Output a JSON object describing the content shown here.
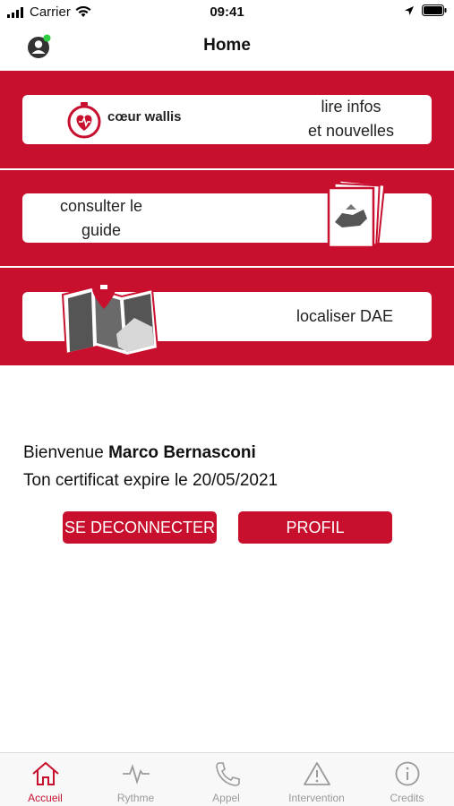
{
  "status_bar": {
    "carrier": "Carrier",
    "time": "09:41",
    "icons": [
      "signal-icon",
      "wifi-icon",
      "location-arrow-icon",
      "battery-icon"
    ]
  },
  "nav": {
    "title": "Home",
    "avatar_icon": "user-avatar-icon",
    "online_dot_color": "#2ecc40"
  },
  "cards": {
    "news": {
      "brand": "cœur wallis",
      "label_line1": "lire infos",
      "label_line2": "et nouvelles"
    },
    "guide": {
      "label_line1": "consulter le",
      "label_line2": "guide"
    },
    "map": {
      "label": "localiser DAE"
    }
  },
  "welcome": {
    "greeting_prefix": "Bienvenue ",
    "user_name": "Marco Bernasconi",
    "certificate_text": "Ton certificat expire le 20/05/2021"
  },
  "buttons": {
    "logout_label": "SE DECONNECTER",
    "profile_label": "PROFIL"
  },
  "tabbar": {
    "tabs": [
      {
        "label": "Accueil",
        "icon": "home-icon",
        "active": true
      },
      {
        "label": "Rythme",
        "icon": "heartbeat-icon",
        "active": false
      },
      {
        "label": "Appel",
        "icon": "phone-icon",
        "active": false
      },
      {
        "label": "Intervention",
        "icon": "warning-icon",
        "active": false
      },
      {
        "label": "Credits",
        "icon": "info-icon",
        "active": false
      }
    ]
  },
  "colors": {
    "brand_red": "#c8102e",
    "tab_inactive": "#9a9a9a"
  }
}
